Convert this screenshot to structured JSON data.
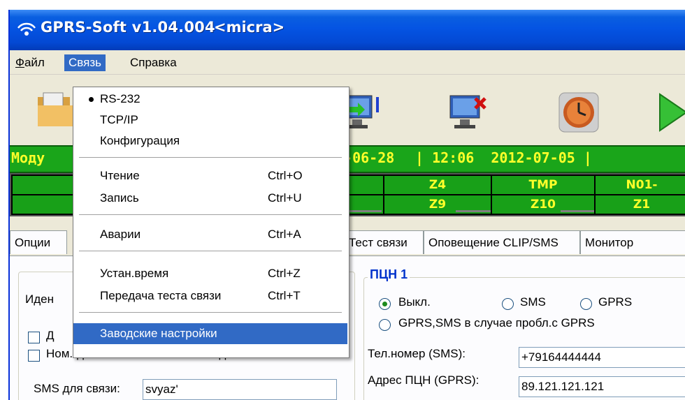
{
  "window": {
    "title": "GPRS-Soft v1.04.004",
    "subtitle": "<micra>"
  },
  "menubar": {
    "items": [
      "Файл",
      "Связь",
      "Справка"
    ]
  },
  "toolbar": {
    "icons": [
      "open-file-icon",
      "connect-icon",
      "disconnect-icon",
      "clock-icon",
      "play-icon"
    ]
  },
  "status": {
    "left": "Моду",
    "date1": "2-06-28",
    "time_date": "| 12:06  2012-07-05 |"
  },
  "zones": {
    "row1": [
      "Z4",
      "TMP",
      "N01-"
    ],
    "row2": [
      "Z9",
      "Z10",
      "Z1"
    ]
  },
  "tabs": [
    "Опции",
    "Тест связи",
    "Оповещение CLIP/SMS",
    "Монитор"
  ],
  "dropdown": {
    "items": [
      {
        "label": "RS-232",
        "shortcut": "",
        "checked": true
      },
      {
        "label": "TCP/IP",
        "shortcut": ""
      },
      {
        "label": "Конфигурация",
        "shortcut": ""
      },
      {
        "label": "Чтение",
        "shortcut": "Ctrl+O"
      },
      {
        "label": "Запись",
        "shortcut": "Ctrl+U"
      },
      {
        "label": "Аварии",
        "shortcut": "Ctrl+A"
      },
      {
        "label": "Устан.время",
        "shortcut": "Ctrl+Z"
      },
      {
        "label": "Передача теста связи",
        "shortcut": "Ctrl+T"
      },
      {
        "label": "Заводские настройки",
        "shortcut": "",
        "highlighted": true
      }
    ]
  },
  "left_panel": {
    "ident_label": "Иден",
    "checkbox1_label": "Д",
    "checkbox2_label": "Ном.\"для связи\" из списка ном.для опов.",
    "sms_label": "SMS для связи:",
    "sms_value": "svyaz'"
  },
  "pcn": {
    "title": "ПЦН 1",
    "radio_off": "Выкл.",
    "radio_sms": "SMS",
    "radio_gprs": "GPRS",
    "radio_gprs_sms": "GPRS,SMS в случае пробл.с GPRS",
    "phone_label": "Тел.номер (SMS):",
    "phone_value": "+79164444444",
    "address_label": "Адрес ПЦН (GPRS):",
    "address_value": "89.121.121.121"
  },
  "colors": {
    "title_blue": "#0554e3",
    "status_green": "#1aa51a",
    "status_text": "#ffff2a",
    "menu_highlight": "#316ac5"
  }
}
